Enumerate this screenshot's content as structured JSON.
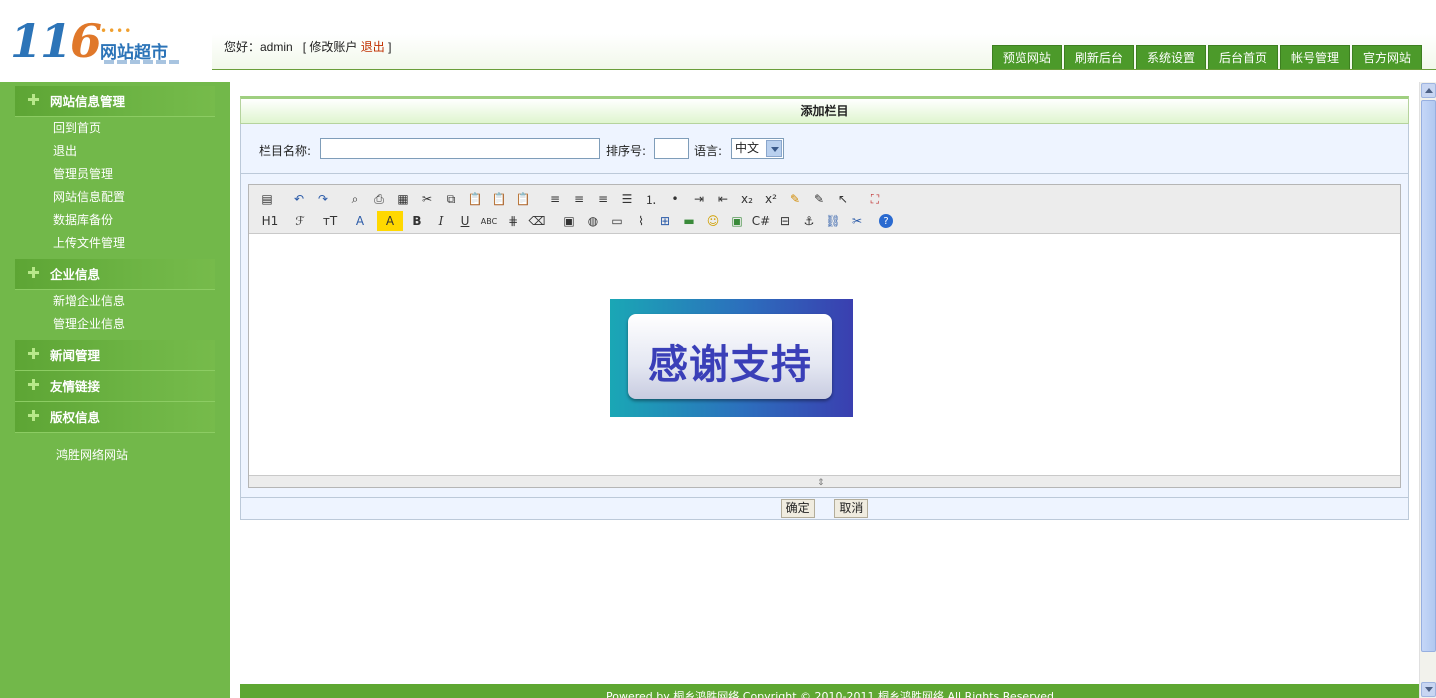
{
  "header": {
    "logo_number": "116",
    "logo_text": "网站超市",
    "greeting_prefix": "您好：admin",
    "greeting_bracket_open": "[",
    "modify_account": "修改账户",
    "logout": "退出",
    "greeting_bracket_close": "]",
    "nav": [
      "预览网站",
      "刷新后台",
      "系统设置",
      "后台首页",
      "帐号管理",
      "官方网站"
    ]
  },
  "sidebar": {
    "sections": [
      {
        "title": "网站信息管理",
        "items": [
          "回到首页",
          "退出",
          "管理员管理",
          "网站信息配置",
          "数据库备份",
          "上传文件管理"
        ]
      },
      {
        "title": "企业信息",
        "items": [
          "新增企业信息",
          "管理企业信息"
        ]
      },
      {
        "title": "新闻管理",
        "items": []
      },
      {
        "title": "友情链接",
        "items": []
      },
      {
        "title": "版权信息",
        "items": []
      }
    ],
    "footer_link": "鸿胜网络网站"
  },
  "panel": {
    "title": "添加栏目",
    "name_label": "栏目名称:",
    "order_label": "排序号:",
    "lang_label": "语言:",
    "lang_value": "中文",
    "name_value": "",
    "order_value": ""
  },
  "editor": {
    "image_text": "感谢支持",
    "toolbar_row2_text": {
      "h1": "H1",
      "font": "ℱ",
      "size": "ᴛT",
      "color": "A",
      "bold": "B",
      "italic": "I",
      "underline": "U",
      "strike": "ABC"
    }
  },
  "actions": {
    "confirm": "确定",
    "cancel": "取消"
  },
  "footer": {
    "text": "Powered by 桐乡鸿胜网络 Copyright © 2010-2011 桐乡鸿胜网络 All Rights Reserved"
  },
  "colors": {
    "sidebar": "#72b84a",
    "nav_button": "#4c9a2a",
    "logout_link": "#c03000"
  }
}
